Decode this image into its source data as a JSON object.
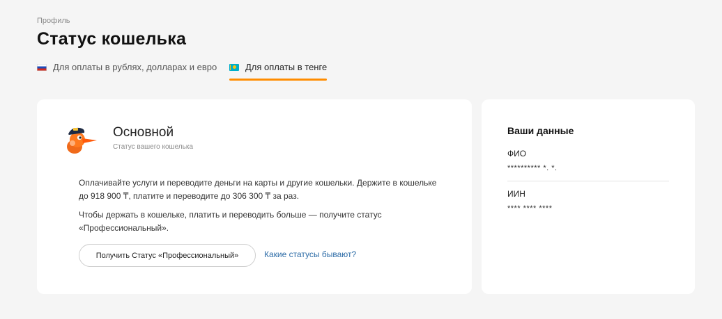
{
  "breadcrumb": "Профиль",
  "page_title": "Статус кошелька",
  "tabs": [
    {
      "label": "Для оплаты в рублях, долларах и евро",
      "flag": "russia-flag-icon",
      "active": false
    },
    {
      "label": "Для оплаты в тенге",
      "flag": "kazakhstan-flag-icon",
      "active": true
    }
  ],
  "status_card": {
    "mascot": "fox-mascot-icon",
    "status_name": "Основной",
    "status_subtitle": "Статус вашего кошелька",
    "description_1": "Оплачивайте услуги и переводите деньги на карты и другие кошельки. Держите в кошельке до 918 900 ₸, платите и переводите до 306 300 ₸ за раз.",
    "description_2": "Чтобы держать в кошельке, платить и переводить больше — получите статус «Профессиональный».",
    "upgrade_button": "Получить Статус «Профессиональный»",
    "statuses_link": "Какие статусы бывают?"
  },
  "user_data": {
    "title": "Ваши данные",
    "fio_label": "ФИО",
    "fio_value": "********** *. *.",
    "iin_label": "ИИН",
    "iin_value": "**** **** ****"
  },
  "colors": {
    "background": "#f5f5f5",
    "card": "#ffffff",
    "accent": "#ff8c00",
    "link": "#2d6ca7"
  }
}
